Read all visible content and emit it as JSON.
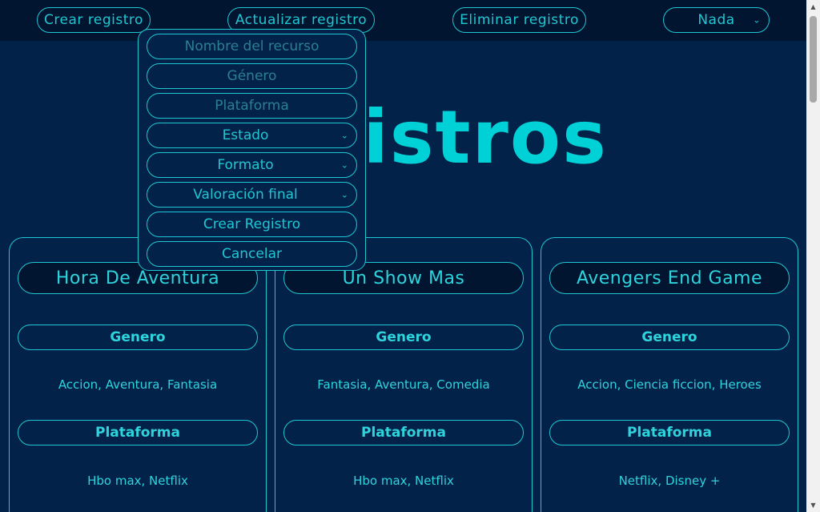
{
  "nav": {
    "create_label": "Crear registro",
    "update_label": "Actualizar registro",
    "delete_label": "Eliminar registro",
    "filter_value": "Nada"
  },
  "page": {
    "title": "Registros"
  },
  "form": {
    "name_placeholder": "Nombre del recurso",
    "genre_placeholder": "Género",
    "platform_placeholder": "Plataforma",
    "status_value": "Estado",
    "format_value": "Formato",
    "rating_value": "Valoración final",
    "submit_label": "Crear Registro",
    "cancel_label": "Cancelar"
  },
  "cards": [
    {
      "title": "Hora De Aventura",
      "genre_label": "Genero",
      "genres": "Accion, Aventura, Fantasia",
      "platform_label": "Plataforma",
      "platforms": "Hbo max, Netflix"
    },
    {
      "title": "Un Show Mas",
      "genre_label": "Genero",
      "genres": "Fantasia, Aventura, Comedia",
      "platform_label": "Plataforma",
      "platforms": "Hbo max, Netflix"
    },
    {
      "title": "Avengers End Game",
      "genre_label": "Genero",
      "genres": "Accion, Ciencia ficcion, Heroes",
      "platform_label": "Plataforma",
      "platforms": "Netflix, Disney +"
    }
  ]
}
